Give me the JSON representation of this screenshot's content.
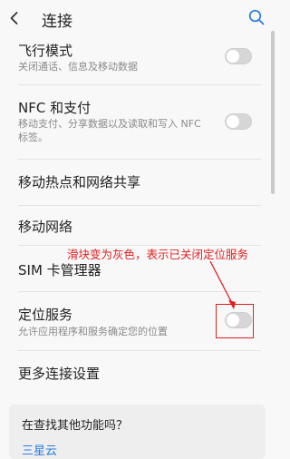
{
  "header": {
    "title": "连接"
  },
  "items": [
    {
      "title": "飞行模式",
      "subtitle": "关闭通话、信息及移动数据"
    },
    {
      "title": "NFC 和支付",
      "subtitle": "移动支付、分享数据以及读取和写入 NFC 标签。"
    },
    {
      "title": "移动热点和网络共享"
    },
    {
      "title": "移动网络"
    },
    {
      "title": "SIM 卡管理器"
    },
    {
      "title": "定位服务",
      "subtitle": "允许应用程序和服务确定您的位置"
    },
    {
      "title": "更多连接设置"
    }
  ],
  "toggles": {
    "airplane_mode": false,
    "nfc": false,
    "location": false
  },
  "annotation": {
    "text": "滑块变为灰色，表示已关闭定位服务",
    "color": "#e02020"
  },
  "card": {
    "title": "在查找其他功能吗？",
    "link": "三星云"
  },
  "colors": {
    "link": "#2b7de3",
    "annotation": "#e02020",
    "toggle_off": "#d6d6d6"
  }
}
